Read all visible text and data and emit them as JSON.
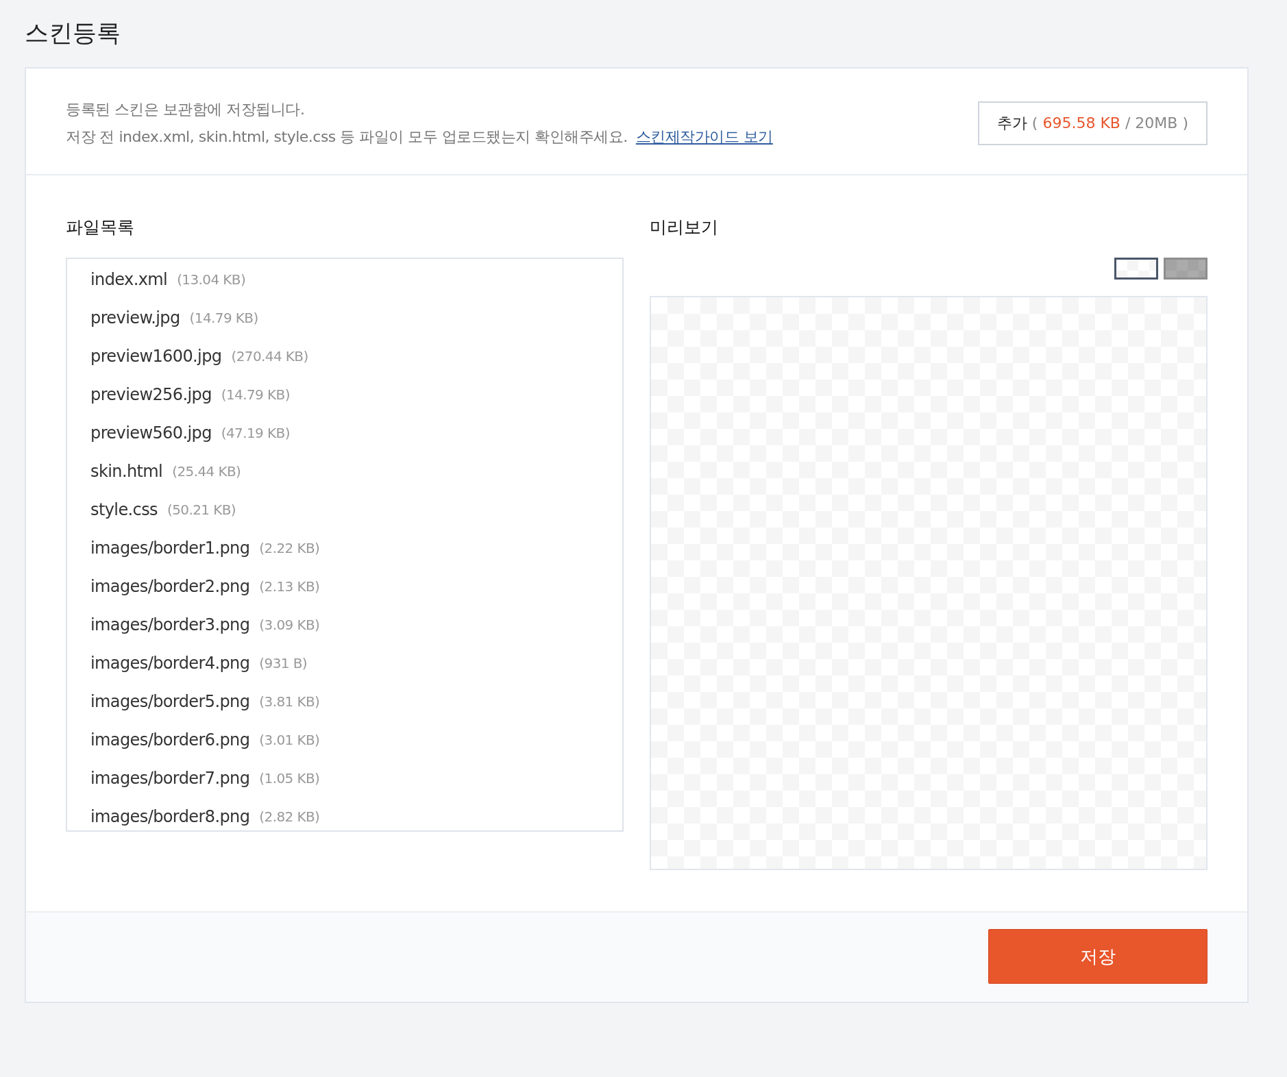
{
  "page_title": "스킨등록",
  "notice": {
    "lines": [
      "등록된 스킨은 보관함에 저장됩니다.",
      "저장 전 index.xml, skin.html, style.css 등 파일이 모두 업로드됐는지 확인해주세요."
    ],
    "guide_link": "스킨제작가이드 보기"
  },
  "add_button": {
    "label": "추가",
    "open": "(",
    "used": "695.58 KB",
    "limit": "/ 20MB",
    "close": ")"
  },
  "file_list": {
    "title": "파일목록",
    "files": [
      {
        "name": "index.xml",
        "size": "(13.04 KB)"
      },
      {
        "name": "preview.jpg",
        "size": "(14.79 KB)"
      },
      {
        "name": "preview1600.jpg",
        "size": "(270.44 KB)"
      },
      {
        "name": "preview256.jpg",
        "size": "(14.79 KB)"
      },
      {
        "name": "preview560.jpg",
        "size": "(47.19 KB)"
      },
      {
        "name": "skin.html",
        "size": "(25.44 KB)"
      },
      {
        "name": "style.css",
        "size": "(50.21 KB)"
      },
      {
        "name": "images/border1.png",
        "size": "(2.22 KB)"
      },
      {
        "name": "images/border2.png",
        "size": "(2.13 KB)"
      },
      {
        "name": "images/border3.png",
        "size": "(3.09 KB)"
      },
      {
        "name": "images/border4.png",
        "size": "(931 B)"
      },
      {
        "name": "images/border5.png",
        "size": "(3.81 KB)"
      },
      {
        "name": "images/border6.png",
        "size": "(3.01 KB)"
      },
      {
        "name": "images/border7.png",
        "size": "(1.05 KB)"
      },
      {
        "name": "images/border8.png",
        "size": "(2.82 KB)"
      }
    ]
  },
  "preview": {
    "title": "미리보기",
    "backgrounds": [
      {
        "kind": "light",
        "selected": true
      },
      {
        "kind": "dark",
        "selected": false
      }
    ]
  },
  "save_button": "저장"
}
